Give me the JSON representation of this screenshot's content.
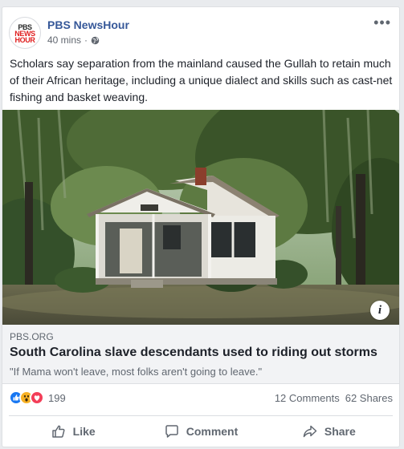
{
  "post": {
    "page_name": "PBS NewsHour",
    "avatar_text": [
      "PBS",
      "NEWS",
      "HOUR"
    ],
    "timestamp": "40 mins",
    "separator": "·",
    "more_label": "•••",
    "body_text": "Scholars say separation from the mainland caused the Gullah to retain much of their African heritage, including a unique dialect and skills such as cast-net fishing and basket weaving."
  },
  "link": {
    "domain": "PBS.ORG",
    "headline": "South Carolina slave descendants used to riding out storms",
    "subtitle": "\"If Mama won't leave, most folks aren't going to leave.\"",
    "info_label": "i"
  },
  "stats": {
    "reaction_count": "199",
    "comments": "12 Comments",
    "shares": "62 Shares",
    "reactions": [
      "like",
      "wow",
      "love"
    ]
  },
  "actions": {
    "like": "Like",
    "comment": "Comment",
    "share": "Share"
  },
  "colors": {
    "page_name": "#365899",
    "like_blue": "#1877f2",
    "wow_yellow": "#f7b125",
    "love_red": "#f33e58",
    "meta_gray": "#616770",
    "background": "#e9ebee"
  },
  "icons": {
    "globe": "globe-icon",
    "more": "more-icon",
    "like": "thumbs-up-icon",
    "comment": "comment-icon",
    "share": "share-icon",
    "info": "info-icon"
  }
}
